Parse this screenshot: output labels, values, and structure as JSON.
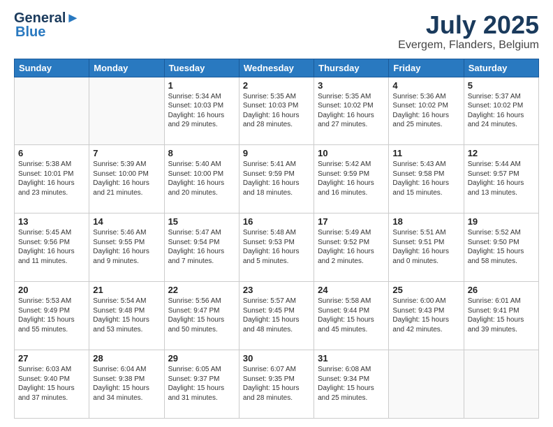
{
  "header": {
    "logo_line1": "General",
    "logo_line2": "Blue",
    "title": "July 2025",
    "subtitle": "Evergem, Flanders, Belgium"
  },
  "days_of_week": [
    "Sunday",
    "Monday",
    "Tuesday",
    "Wednesday",
    "Thursday",
    "Friday",
    "Saturday"
  ],
  "weeks": [
    [
      {
        "day": "",
        "content": ""
      },
      {
        "day": "",
        "content": ""
      },
      {
        "day": "1",
        "content": "Sunrise: 5:34 AM\nSunset: 10:03 PM\nDaylight: 16 hours\nand 29 minutes."
      },
      {
        "day": "2",
        "content": "Sunrise: 5:35 AM\nSunset: 10:03 PM\nDaylight: 16 hours\nand 28 minutes."
      },
      {
        "day": "3",
        "content": "Sunrise: 5:35 AM\nSunset: 10:02 PM\nDaylight: 16 hours\nand 27 minutes."
      },
      {
        "day": "4",
        "content": "Sunrise: 5:36 AM\nSunset: 10:02 PM\nDaylight: 16 hours\nand 25 minutes."
      },
      {
        "day": "5",
        "content": "Sunrise: 5:37 AM\nSunset: 10:02 PM\nDaylight: 16 hours\nand 24 minutes."
      }
    ],
    [
      {
        "day": "6",
        "content": "Sunrise: 5:38 AM\nSunset: 10:01 PM\nDaylight: 16 hours\nand 23 minutes."
      },
      {
        "day": "7",
        "content": "Sunrise: 5:39 AM\nSunset: 10:00 PM\nDaylight: 16 hours\nand 21 minutes."
      },
      {
        "day": "8",
        "content": "Sunrise: 5:40 AM\nSunset: 10:00 PM\nDaylight: 16 hours\nand 20 minutes."
      },
      {
        "day": "9",
        "content": "Sunrise: 5:41 AM\nSunset: 9:59 PM\nDaylight: 16 hours\nand 18 minutes."
      },
      {
        "day": "10",
        "content": "Sunrise: 5:42 AM\nSunset: 9:59 PM\nDaylight: 16 hours\nand 16 minutes."
      },
      {
        "day": "11",
        "content": "Sunrise: 5:43 AM\nSunset: 9:58 PM\nDaylight: 16 hours\nand 15 minutes."
      },
      {
        "day": "12",
        "content": "Sunrise: 5:44 AM\nSunset: 9:57 PM\nDaylight: 16 hours\nand 13 minutes."
      }
    ],
    [
      {
        "day": "13",
        "content": "Sunrise: 5:45 AM\nSunset: 9:56 PM\nDaylight: 16 hours\nand 11 minutes."
      },
      {
        "day": "14",
        "content": "Sunrise: 5:46 AM\nSunset: 9:55 PM\nDaylight: 16 hours\nand 9 minutes."
      },
      {
        "day": "15",
        "content": "Sunrise: 5:47 AM\nSunset: 9:54 PM\nDaylight: 16 hours\nand 7 minutes."
      },
      {
        "day": "16",
        "content": "Sunrise: 5:48 AM\nSunset: 9:53 PM\nDaylight: 16 hours\nand 5 minutes."
      },
      {
        "day": "17",
        "content": "Sunrise: 5:49 AM\nSunset: 9:52 PM\nDaylight: 16 hours\nand 2 minutes."
      },
      {
        "day": "18",
        "content": "Sunrise: 5:51 AM\nSunset: 9:51 PM\nDaylight: 16 hours\nand 0 minutes."
      },
      {
        "day": "19",
        "content": "Sunrise: 5:52 AM\nSunset: 9:50 PM\nDaylight: 15 hours\nand 58 minutes."
      }
    ],
    [
      {
        "day": "20",
        "content": "Sunrise: 5:53 AM\nSunset: 9:49 PM\nDaylight: 15 hours\nand 55 minutes."
      },
      {
        "day": "21",
        "content": "Sunrise: 5:54 AM\nSunset: 9:48 PM\nDaylight: 15 hours\nand 53 minutes."
      },
      {
        "day": "22",
        "content": "Sunrise: 5:56 AM\nSunset: 9:47 PM\nDaylight: 15 hours\nand 50 minutes."
      },
      {
        "day": "23",
        "content": "Sunrise: 5:57 AM\nSunset: 9:45 PM\nDaylight: 15 hours\nand 48 minutes."
      },
      {
        "day": "24",
        "content": "Sunrise: 5:58 AM\nSunset: 9:44 PM\nDaylight: 15 hours\nand 45 minutes."
      },
      {
        "day": "25",
        "content": "Sunrise: 6:00 AM\nSunset: 9:43 PM\nDaylight: 15 hours\nand 42 minutes."
      },
      {
        "day": "26",
        "content": "Sunrise: 6:01 AM\nSunset: 9:41 PM\nDaylight: 15 hours\nand 39 minutes."
      }
    ],
    [
      {
        "day": "27",
        "content": "Sunrise: 6:03 AM\nSunset: 9:40 PM\nDaylight: 15 hours\nand 37 minutes."
      },
      {
        "day": "28",
        "content": "Sunrise: 6:04 AM\nSunset: 9:38 PM\nDaylight: 15 hours\nand 34 minutes."
      },
      {
        "day": "29",
        "content": "Sunrise: 6:05 AM\nSunset: 9:37 PM\nDaylight: 15 hours\nand 31 minutes."
      },
      {
        "day": "30",
        "content": "Sunrise: 6:07 AM\nSunset: 9:35 PM\nDaylight: 15 hours\nand 28 minutes."
      },
      {
        "day": "31",
        "content": "Sunrise: 6:08 AM\nSunset: 9:34 PM\nDaylight: 15 hours\nand 25 minutes."
      },
      {
        "day": "",
        "content": ""
      },
      {
        "day": "",
        "content": ""
      }
    ]
  ]
}
